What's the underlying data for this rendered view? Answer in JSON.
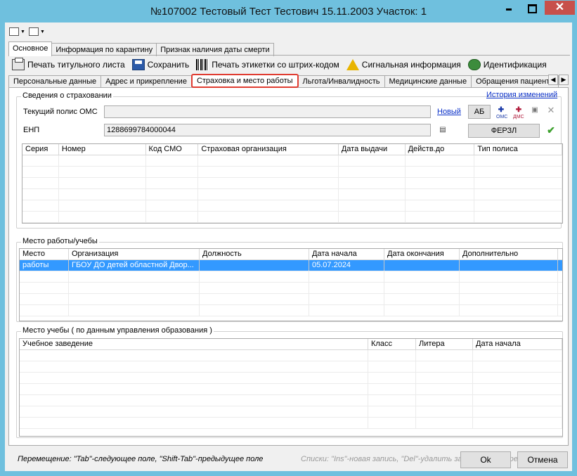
{
  "window": {
    "title": "№107002 Тестовый Тест Тестович 15.11.2003 Участок: 1"
  },
  "top_tabs": [
    "Основное",
    "Информация по карантину",
    "Признак наличия даты смерти"
  ],
  "toolbar": {
    "print_title": "Печать титульного листа",
    "save": "Сохранить",
    "print_label": "Печать этикетки со штрих-кодом",
    "signal": "Сигнальная информация",
    "ident": "Идентификация"
  },
  "sub_tabs": [
    "Персональные данные",
    "Адрес и прикрепление",
    "Страховка и место работы",
    "Льгота/Инвалидность",
    "Медицинские данные",
    "Обращения пациента"
  ],
  "insurance": {
    "group_title": "Сведения о страховании",
    "history_link": "История изменений",
    "policy_label": "Текущий полис ОМС",
    "policy_value": "",
    "new_link": "Новый",
    "ab_button": "АБ",
    "enp_label": "ЕНП",
    "enp_value": "1288699784000044",
    "ferzl_button": "ФЕРЗЛ",
    "oms_icon_label": "ОМС",
    "dms_icon_label": "ДМС",
    "columns": [
      "Серия",
      "Номер",
      "Код СМО",
      "Страховая организация",
      "Дата выдачи",
      "Действ.до",
      "Тип полиса"
    ]
  },
  "work": {
    "group_title": "Место работы/учебы",
    "columns": [
      "Место",
      "Организация",
      "Должность",
      "Дата начала",
      "Дата окончания",
      "Дополнительно"
    ],
    "rows": [
      [
        "работы",
        "ГБОУ ДО детей областной Двор...",
        "",
        "05.07.2024",
        "",
        ""
      ]
    ]
  },
  "study": {
    "group_title": "Место учебы ( по данным управления образования )",
    "columns": [
      "Учебное заведение",
      "Класс",
      "Литера",
      "Дата начала"
    ]
  },
  "hints": {
    "left": "Перемещение: \"Tab\"-следующее поле, \"Shift-Tab\"-предыдущее поле",
    "right": "Списки: \"Ins\"-новая запись, \"Del\"-удалить запись; \"Enter\"-редактиро"
  },
  "buttons": {
    "ok": "Ok",
    "cancel": "Отмена"
  },
  "colors": {
    "accent_tab_border": "#e03c31",
    "selection": "#3399ff",
    "link": "#0a30c8",
    "window_frame": "#6fc0de"
  }
}
